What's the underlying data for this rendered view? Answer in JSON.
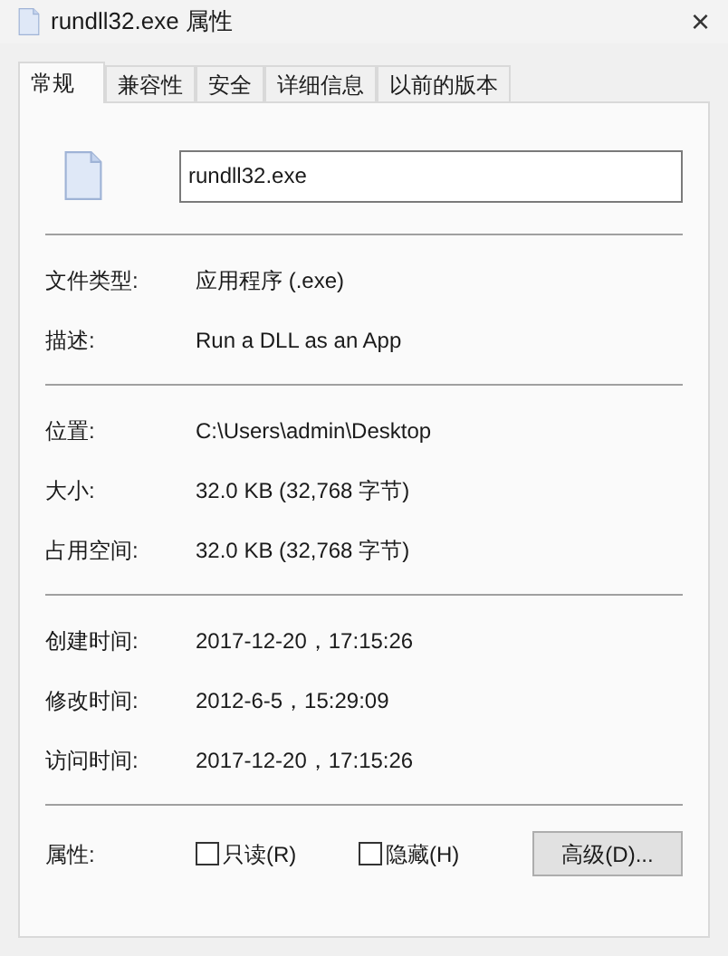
{
  "window": {
    "title": "rundll32.exe 属性",
    "close": "×"
  },
  "tabs": [
    {
      "label": "常规",
      "selected": true
    },
    {
      "label": "兼容性",
      "selected": false
    },
    {
      "label": "安全",
      "selected": false
    },
    {
      "label": "详细信息",
      "selected": false
    },
    {
      "label": "以前的版本",
      "selected": false
    }
  ],
  "name_field": {
    "value": "rundll32.exe"
  },
  "groups": [
    [
      {
        "label": "文件类型:",
        "value": "应用程序 (.exe)"
      },
      {
        "label": "描述:",
        "value": "Run a DLL as an App"
      }
    ],
    [
      {
        "label": "位置:",
        "value": "C:\\Users\\admin\\Desktop"
      },
      {
        "label": "大小:",
        "value": "32.0 KB (32,768 字节)"
      },
      {
        "label": "占用空间:",
        "value": "32.0 KB (32,768 字节)"
      }
    ],
    [
      {
        "label": "创建时间:",
        "value": "2017-12-20，17:15:26"
      },
      {
        "label": "修改时间:",
        "value": "2012-6-5，15:29:09"
      },
      {
        "label": "访问时间:",
        "value": "2017-12-20，17:15:26"
      }
    ]
  ],
  "attributes": {
    "label": "属性:",
    "checkboxes": [
      {
        "label": "只读(R)",
        "checked": false
      },
      {
        "label": "隐藏(H)",
        "checked": false
      }
    ],
    "button": "高级(D)..."
  }
}
